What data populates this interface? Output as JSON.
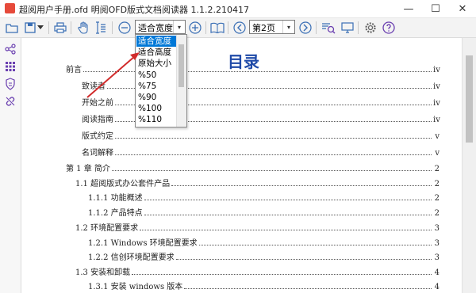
{
  "window": {
    "title": "超阅用户手册.ofd 明阅OFD版式文档阅读器 1.1.2.210417",
    "min_label": "—",
    "max_label": "☐",
    "close_label": "✕"
  },
  "toolbar": {
    "zoom_value": "适合宽度",
    "page_value": "第2页",
    "zoom_arrow": "▾",
    "page_arrow": "▾"
  },
  "zoom_dropdown": {
    "options": [
      "适合宽度",
      "适合高度",
      "原始大小",
      "%50",
      "%75",
      "%90",
      "%100",
      "%110"
    ],
    "selected_index": 0
  },
  "document": {
    "toc_title": "目录",
    "entries": [
      {
        "label": "前言",
        "page": "iv"
      },
      {
        "label": "致读者",
        "page": "iv"
      },
      {
        "label": "开始之前",
        "page": "iv"
      },
      {
        "label": "阅读指南",
        "page": "iv"
      },
      {
        "label": "版式约定",
        "page": "v"
      },
      {
        "label": "名词解释",
        "page": "v"
      },
      {
        "label": "第 1 章  简介",
        "page": "2"
      },
      {
        "label": "1.1  超阅版式办公套件产品",
        "page": "2"
      },
      {
        "label": "1.1.1  功能概述",
        "page": "2"
      },
      {
        "label": "1.1.2  产品特点",
        "page": "2"
      },
      {
        "label": "1.2  环境配置要求",
        "page": "3"
      },
      {
        "label": "1.2.1 Windows 环境配置要求",
        "page": "3"
      },
      {
        "label": "1.2.2  信创环境配置要求",
        "page": "3"
      },
      {
        "label": "1.3  安装和卸载",
        "page": "4"
      },
      {
        "label": "1.3.1  安装 windows 版本",
        "page": "4"
      }
    ]
  },
  "colors": {
    "toc_title": "#1f4aa8",
    "selected_bg": "#0078d7",
    "annotation_arrow": "#d12b2b",
    "icon_blue": "#3a6fb5",
    "icon_purple": "#6a3fb0"
  }
}
